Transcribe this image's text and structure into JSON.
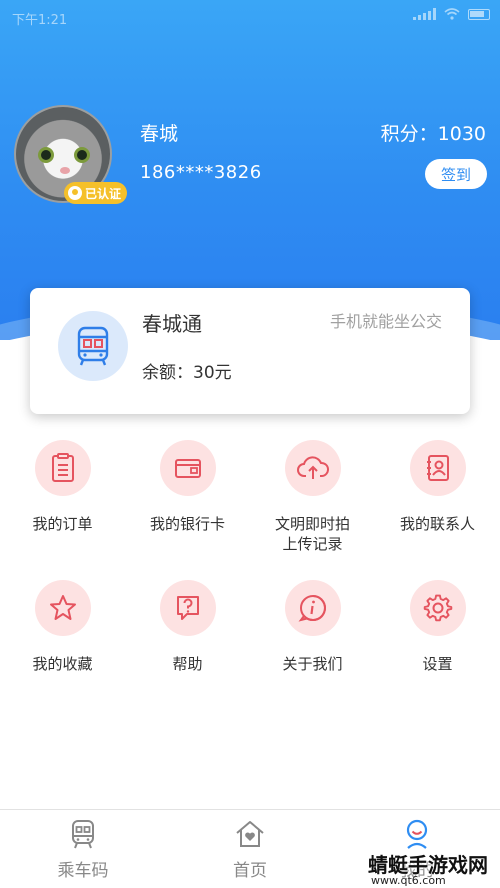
{
  "status_bar": {
    "time": "下午1:21"
  },
  "profile": {
    "name": "春城",
    "phone": "186****3826",
    "verified_label": "已认证",
    "points_label": "积分：1030",
    "checkin_label": "签到"
  },
  "card": {
    "title": "春城通",
    "slogan": "手机就能坐公交",
    "balance": "余额：30元",
    "icon": "bus-card-icon"
  },
  "grid": [
    {
      "label": "我的订单",
      "icon": "order-icon"
    },
    {
      "label": "我的银行卡",
      "icon": "bank-card-icon"
    },
    {
      "label": "文明即时拍\n上传记录",
      "icon": "cloud-upload-icon"
    },
    {
      "label": "我的联系人",
      "icon": "contacts-icon"
    },
    {
      "label": "我的收藏",
      "icon": "star-icon"
    },
    {
      "label": "帮助",
      "icon": "help-icon"
    },
    {
      "label": "关于我们",
      "icon": "info-icon"
    },
    {
      "label": "设置",
      "icon": "gear-icon"
    }
  ],
  "bottom_nav": [
    {
      "label": "乘车码",
      "icon": "train-icon"
    },
    {
      "label": "首页",
      "icon": "home-icon"
    },
    {
      "label": "我的",
      "icon": "user-icon"
    }
  ],
  "watermark": {
    "text": "蜻蜓手游戏网",
    "url": "www.qt6.com"
  },
  "colors": {
    "header_blue": "#2f8df2",
    "icon_bg_pink": "#fde2e2",
    "icon_red": "#e5545f",
    "badge_yellow": "#f5c02a"
  }
}
